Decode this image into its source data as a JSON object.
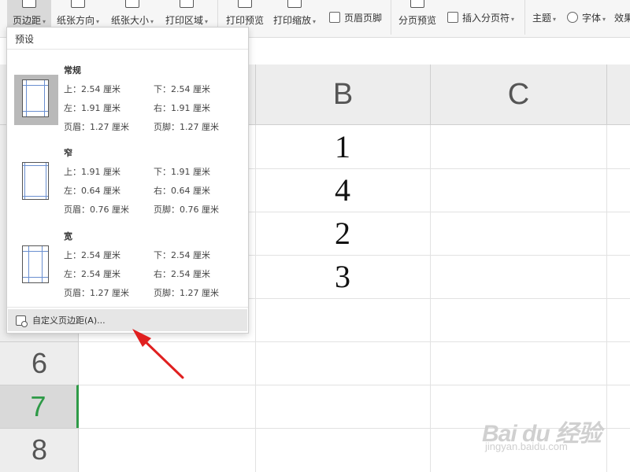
{
  "ribbon": {
    "margins": "页边距",
    "orientation": "纸张方向",
    "paper_size": "纸张大小",
    "print_area": "打印区域",
    "print_preview": "打印预览",
    "print_zoom": "打印缩放",
    "header_footer": "页眉页脚",
    "page_break_preview": "分页预览",
    "insert_page_break": "插入分页符",
    "theme": "主题",
    "font": "字体",
    "effects": "效果"
  },
  "sheet": {
    "columns": [
      "B",
      "C"
    ],
    "row_labels": [
      "6",
      "7",
      "8"
    ],
    "selected_row": "7",
    "values": [
      "1",
      "4",
      "2",
      "3"
    ]
  },
  "margins_menu": {
    "header": "预设",
    "presets": [
      {
        "name": "常规",
        "top": "上：2.54 厘米",
        "bottom": "下：2.54 厘米",
        "left": "左：1.91 厘米",
        "right": "右：1.91 厘米",
        "header": "页眉：1.27 厘米",
        "footer": "页脚：1.27 厘米"
      },
      {
        "name": "窄",
        "top": "上：1.91 厘米",
        "bottom": "下：1.91 厘米",
        "left": "左：0.64 厘米",
        "right": "右：0.64 厘米",
        "header": "页眉：0.76 厘米",
        "footer": "页脚：0.76 厘米"
      },
      {
        "name": "宽",
        "top": "上：2.54 厘米",
        "bottom": "下：2.54 厘米",
        "left": "左：2.54 厘米",
        "right": "右：2.54 厘米",
        "header": "页眉：1.27 厘米",
        "footer": "页脚：1.27 厘米"
      }
    ],
    "custom": "自定义页边距(A)..."
  },
  "colors": {
    "selected_row": "#2e9a47",
    "annotation_arrow": "#e02020",
    "margin_guides": "#6a8fd0"
  },
  "watermark": {
    "logo": "Bai du 经验",
    "url": "jingyan.baidu.com"
  }
}
